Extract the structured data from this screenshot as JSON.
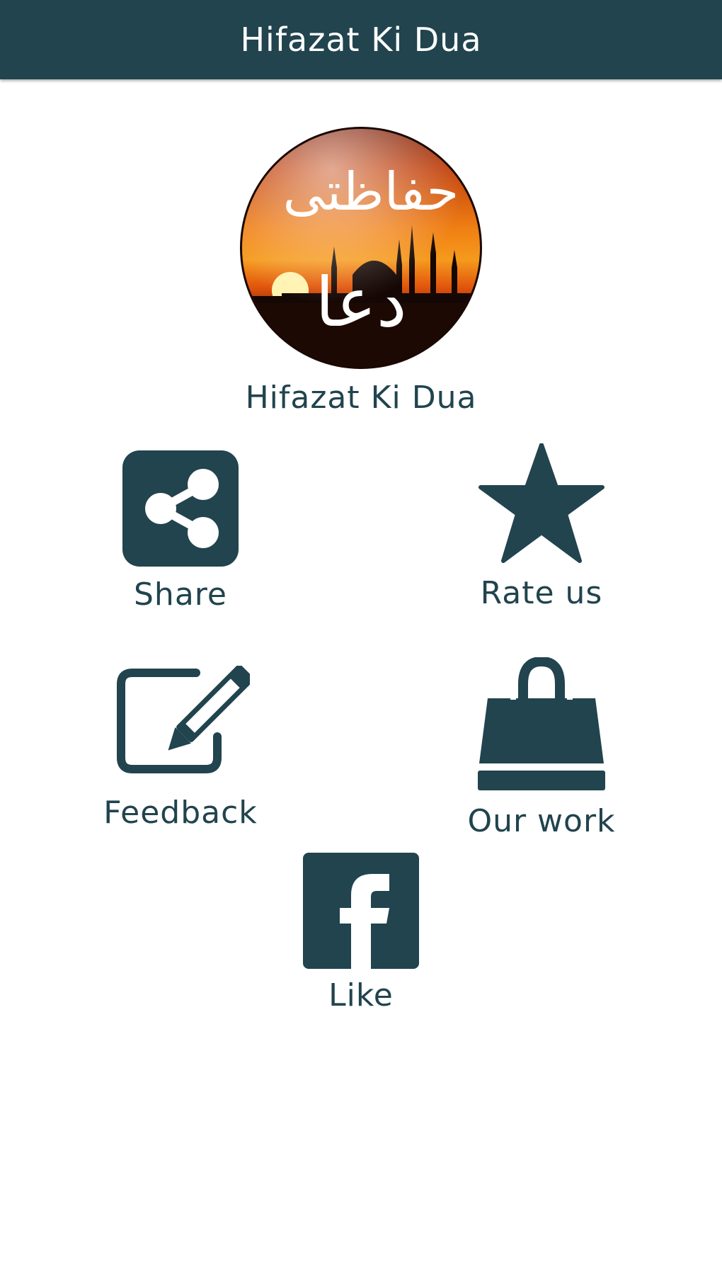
{
  "app": {
    "title": "Hifazat Ki Dua",
    "accent_color": "#21444e"
  },
  "logo": {
    "arabic_text_top": "حفاظتی",
    "arabic_text_bottom": "دعا",
    "caption": "Hifazat Ki Dua"
  },
  "actions": [
    {
      "label": "Share",
      "icon": "share-icon"
    },
    {
      "label": "Rate us",
      "icon": "star-icon"
    },
    {
      "label": "Feedback",
      "icon": "edit-icon"
    },
    {
      "label": "Our work",
      "icon": "shopping-bag-icon"
    },
    {
      "label": "Like",
      "icon": "facebook-icon"
    }
  ]
}
